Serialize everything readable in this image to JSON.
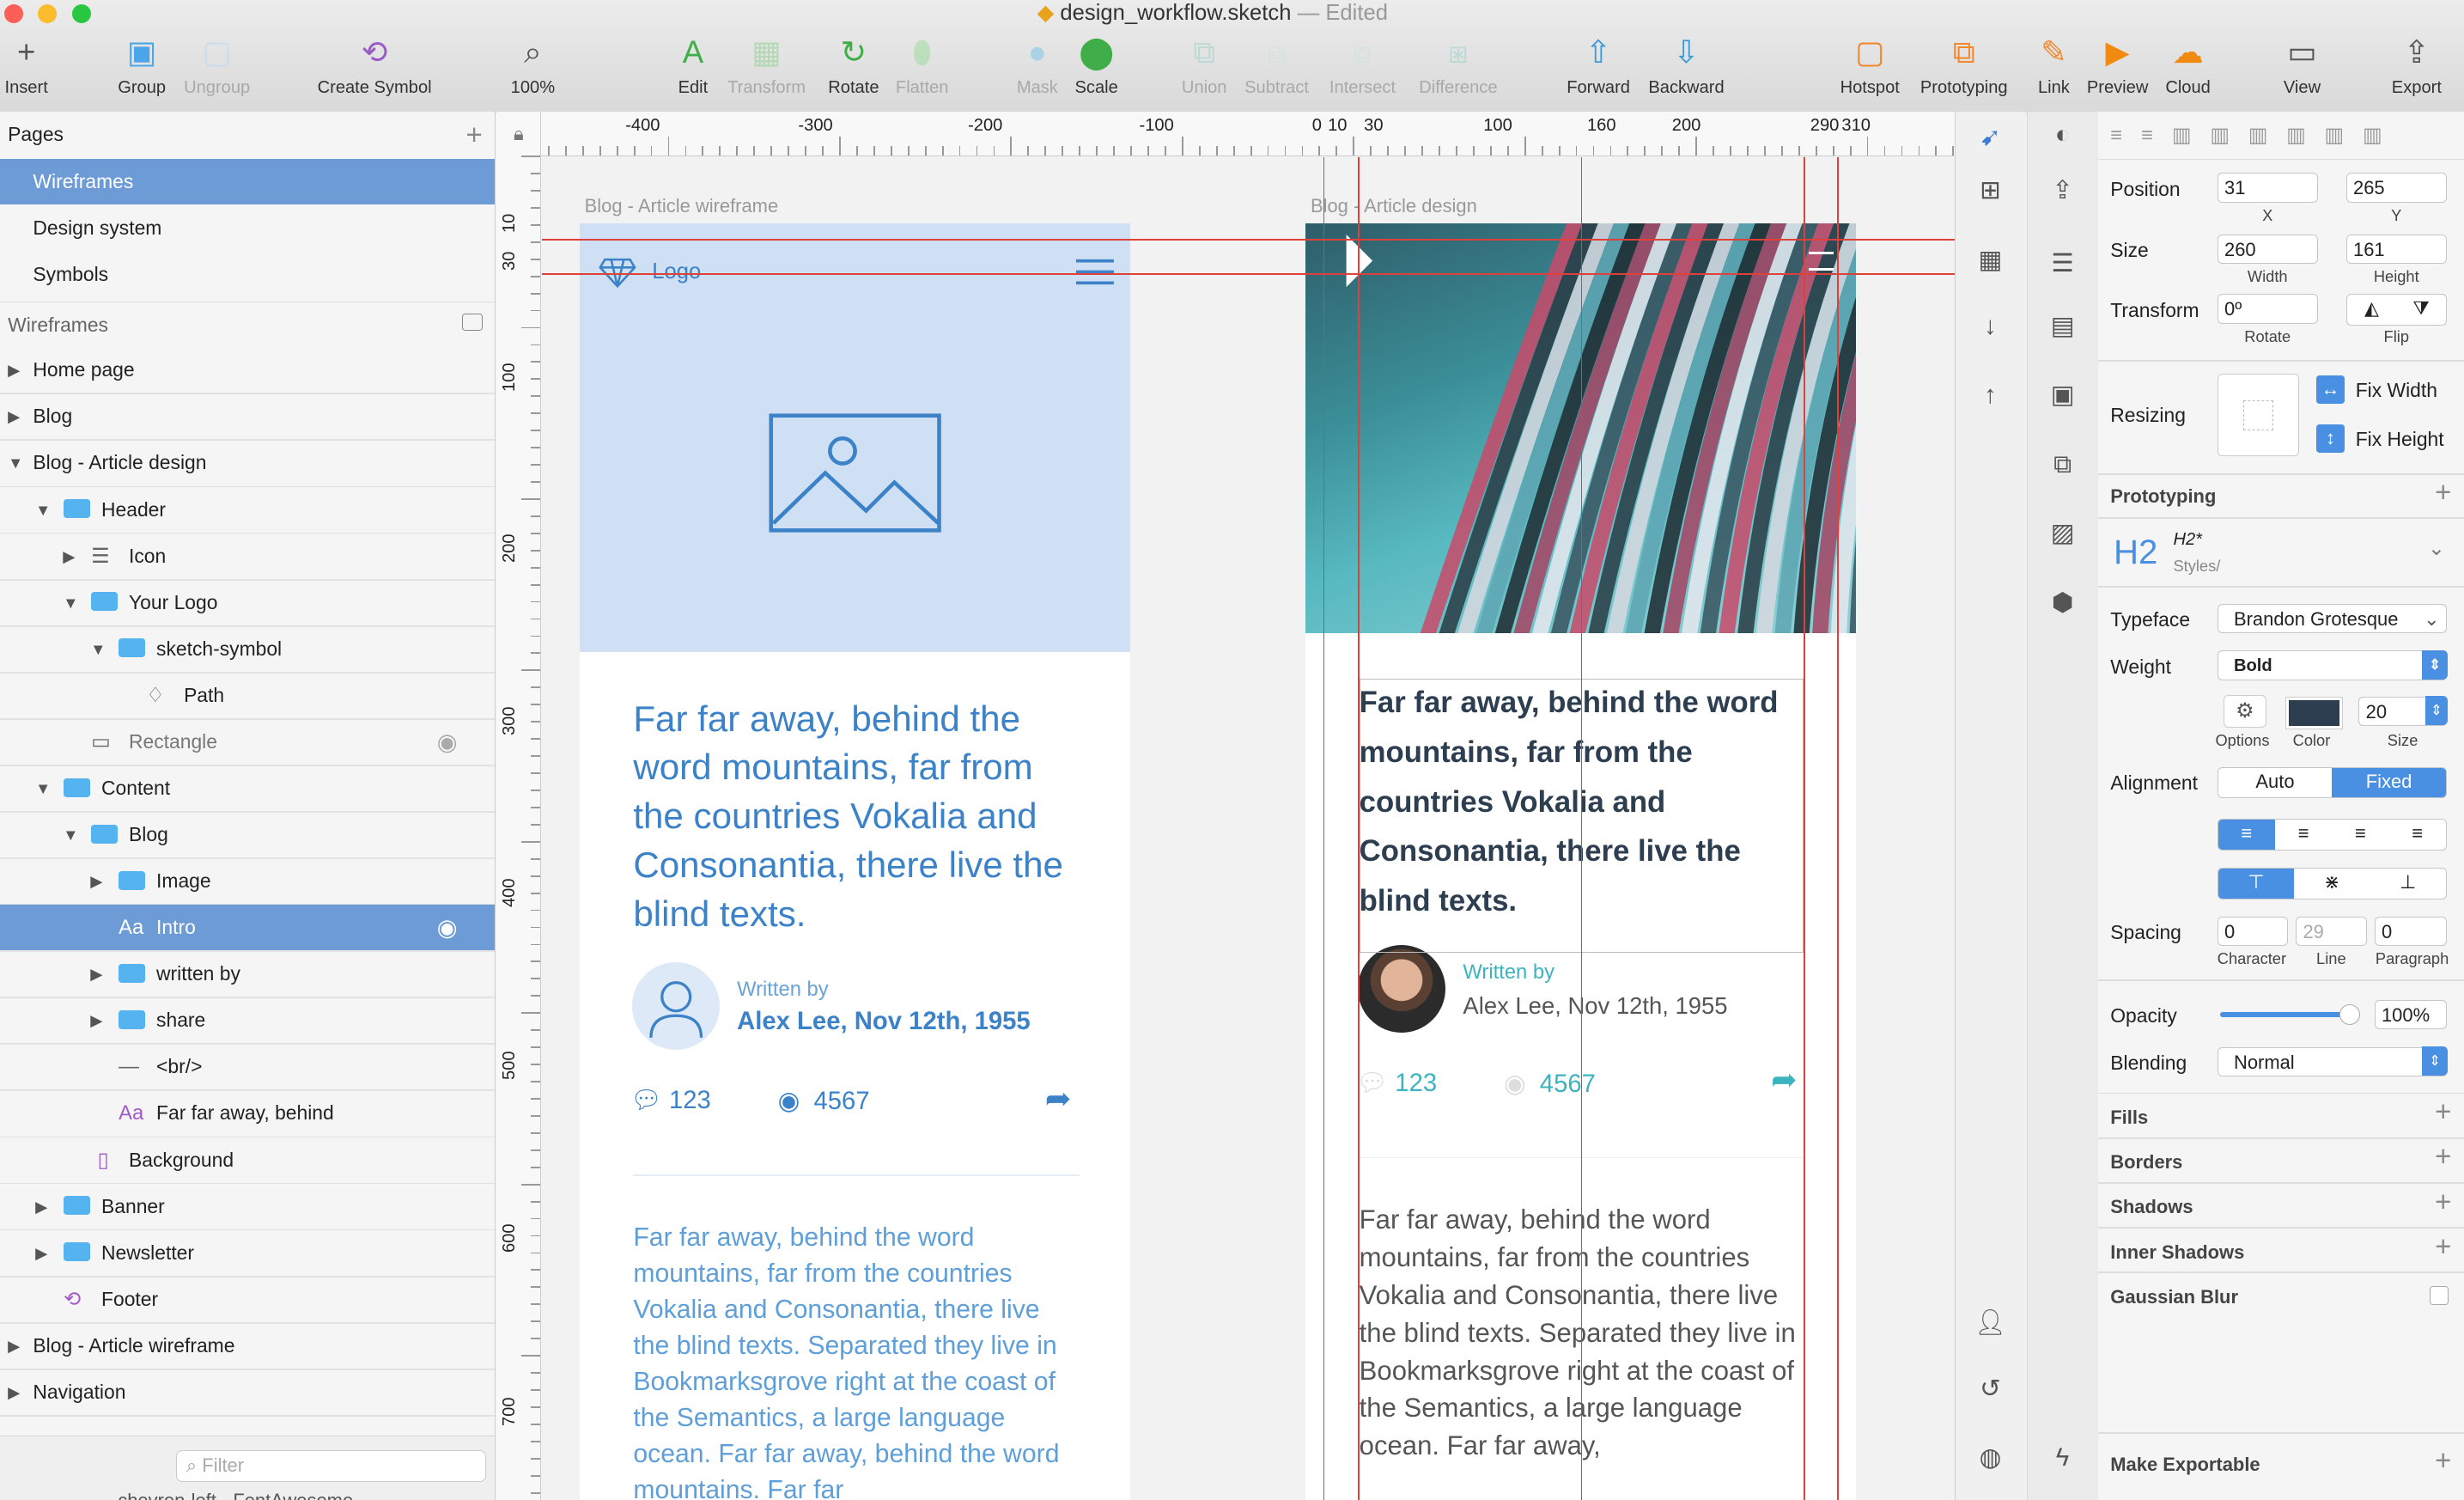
{
  "window": {
    "filename": "design_workflow.sketch",
    "status": "— Edited"
  },
  "toolbar": {
    "items": [
      {
        "label": "Insert",
        "icon": "plus-icon",
        "dis": false
      },
      {
        "label": "Group",
        "icon": "group-icon",
        "dis": false
      },
      {
        "label": "Ungroup",
        "icon": "ungroup-icon",
        "dis": true
      },
      {
        "label": "Create Symbol",
        "icon": "symbol-icon",
        "dis": false
      },
      {
        "label": "100%",
        "icon": "zoom-icon",
        "dis": false
      },
      {
        "label": "Edit",
        "icon": "edit-icon",
        "dis": false
      },
      {
        "label": "Transform",
        "icon": "transform-icon",
        "dis": true
      },
      {
        "label": "Rotate",
        "icon": "rotate-icon",
        "dis": false
      },
      {
        "label": "Flatten",
        "icon": "flatten-icon",
        "dis": true
      },
      {
        "label": "Mask",
        "icon": "mask-icon",
        "dis": true
      },
      {
        "label": "Scale",
        "icon": "scale-icon",
        "dis": false
      },
      {
        "label": "Union",
        "icon": "union-icon",
        "dis": true
      },
      {
        "label": "Subtract",
        "icon": "subtract-icon",
        "dis": true
      },
      {
        "label": "Intersect",
        "icon": "intersect-icon",
        "dis": true
      },
      {
        "label": "Difference",
        "icon": "difference-icon",
        "dis": true
      },
      {
        "label": "Forward",
        "icon": "forward-icon",
        "dis": false
      },
      {
        "label": "Backward",
        "icon": "backward-icon",
        "dis": false
      },
      {
        "label": "Hotspot",
        "icon": "hotspot-icon",
        "dis": false
      },
      {
        "label": "Prototyping",
        "icon": "prototyping-icon",
        "dis": false
      },
      {
        "label": "Link",
        "icon": "link-icon",
        "dis": false
      },
      {
        "label": "Preview",
        "icon": "preview-icon",
        "dis": false
      },
      {
        "label": "Cloud",
        "icon": "cloud-icon",
        "dis": false
      },
      {
        "label": "View",
        "icon": "view-icon",
        "dis": false
      },
      {
        "label": "Export",
        "icon": "export-icon",
        "dis": false
      }
    ]
  },
  "pages": {
    "header": "Pages",
    "items": [
      "Wireframes",
      "Design system",
      "Symbols"
    ]
  },
  "layers": {
    "header": "Wireframes",
    "items": [
      {
        "label": "Home page",
        "tri": "right",
        "indent": 0,
        "kind": "none"
      },
      {
        "label": "Blog",
        "tri": "right",
        "indent": 0,
        "kind": "none"
      },
      {
        "label": "Blog - Article design",
        "tri": "down",
        "indent": 0,
        "kind": "none"
      },
      {
        "label": "Header",
        "tri": "down",
        "indent": 1,
        "kind": "folder"
      },
      {
        "label": "Icon",
        "tri": "right",
        "indent": 2,
        "kind": "lines"
      },
      {
        "label": "Your Logo",
        "tri": "down",
        "indent": 2,
        "kind": "folder"
      },
      {
        "label": "sketch-symbol",
        "tri": "down",
        "indent": 3,
        "kind": "folder"
      },
      {
        "label": "Path",
        "tri": "",
        "indent": 4,
        "kind": "diamond"
      },
      {
        "label": "Rectangle",
        "tri": "",
        "indent": 2,
        "kind": "rect",
        "eye": true,
        "muted": true
      },
      {
        "label": "Content",
        "tri": "down",
        "indent": 1,
        "kind": "folder"
      },
      {
        "label": "Blog",
        "tri": "down",
        "indent": 2,
        "kind": "folder"
      },
      {
        "label": "Image",
        "tri": "right",
        "indent": 3,
        "kind": "folder"
      },
      {
        "label": "Intro",
        "tri": "",
        "indent": 3,
        "kind": "text",
        "sel": true,
        "eye": true
      },
      {
        "label": "written by",
        "tri": "right",
        "indent": 3,
        "kind": "folder"
      },
      {
        "label": "share",
        "tri": "right",
        "indent": 3,
        "kind": "folder"
      },
      {
        "label": "<br/>",
        "tri": "",
        "indent": 3,
        "kind": "line"
      },
      {
        "label": "Far far away, behind",
        "tri": "",
        "indent": 3,
        "kind": "textp"
      },
      {
        "label": "Background",
        "tri": "",
        "indent": 2,
        "kind": "bg"
      },
      {
        "label": "Banner",
        "tri": "right",
        "indent": 1,
        "kind": "folder"
      },
      {
        "label": "Newsletter",
        "tri": "right",
        "indent": 1,
        "kind": "folder"
      },
      {
        "label": "Footer",
        "tri": "",
        "indent": 1,
        "kind": "sym"
      },
      {
        "label": "Blog - Article wireframe",
        "tri": "right",
        "indent": 0,
        "kind": "none"
      },
      {
        "label": "Navigation",
        "tri": "right",
        "indent": 0,
        "kind": "none"
      }
    ],
    "filter_placeholder": "Filter",
    "cut_row": "chevron-left - FontAwesome"
  },
  "ruler": {
    "top": [
      "-400",
      "-300",
      "-200",
      "-100",
      "0",
      "10",
      "30",
      "100",
      "160",
      "200",
      "290",
      "310"
    ],
    "left": [
      "10",
      "30",
      "100",
      "200",
      "300",
      "400",
      "500",
      "600",
      "700"
    ]
  },
  "canvas": {
    "wire_label": "Blog - Article wireframe",
    "design_label": "Blog - Article design",
    "wire": {
      "logo": "Logo",
      "headline": "Far far away, behind the word mountains, far from the countries Vokalia and Consonantia, there live the blind texts.",
      "written_by": "Written by",
      "author": "Alex Lee, Nov 12th, 1955",
      "comments": "123",
      "views": "4567",
      "body": "Far far away, behind the word mountains, far from the countries Vokalia and Consonantia, there live the blind texts. Separated they live in Bookmarksgrove right at the coast of the Semantics, a large language ocean.  Far far away, behind the word mountains. Far far"
    },
    "design": {
      "headline": "Far far away, behind the word mountains, far from the countries Vokalia and Consonantia, there live the blind texts.",
      "written_by": "Written by",
      "author": "Alex Lee, Nov 12th, 1955",
      "comments": "123",
      "views": "4567",
      "body": "Far far away, behind the word mountains, far from the countries Vokalia and Consonantia, there live the blind texts. Separated they live in Bookmarksgrove right at the coast of the Semantics, a large language ocean. Far far away,"
    }
  },
  "inspector": {
    "position_label": "Position",
    "x": "31",
    "y": "265",
    "x_lbl": "X",
    "y_lbl": "Y",
    "size_label": "Size",
    "w": "260",
    "h": "161",
    "w_lbl": "Width",
    "h_lbl": "Height",
    "transform_label": "Transform",
    "rotate": "0º",
    "rotate_lbl": "Rotate",
    "flip_lbl": "Flip",
    "resizing_label": "Resizing",
    "fix_width": "Fix Width",
    "fix_height": "Fix Height",
    "prototyping": "Prototyping",
    "style_name": "H2*",
    "style_path": "Styles/",
    "style_glyph": "H2",
    "typeface_label": "Typeface",
    "typeface": "Brandon Grotesque",
    "weight_label": "Weight",
    "weight": "Bold",
    "options_lbl": "Options",
    "color_lbl": "Color",
    "size_lbl": "Size",
    "font_size": "20",
    "alignment_label": "Alignment",
    "auto": "Auto",
    "fixed": "Fixed",
    "spacing_label": "Spacing",
    "char": "0",
    "line": "29",
    "para": "0",
    "char_lbl": "Character",
    "line_lbl": "Line",
    "para_lbl": "Paragraph",
    "opacity_label": "Opacity",
    "opacity": "100%",
    "opacity_value": 1.0,
    "blending_label": "Blending",
    "blending": "Normal",
    "sections": [
      "Fills",
      "Borders",
      "Shadows",
      "Inner Shadows",
      "Gaussian Blur"
    ],
    "exportable": "Make Exportable",
    "text_color": "#2d3e50"
  },
  "colors": {
    "accent": "#4a90e2",
    "wire_blue": "#3c82c8",
    "teal": "#3cb4c0",
    "guide": "#e0403a"
  }
}
